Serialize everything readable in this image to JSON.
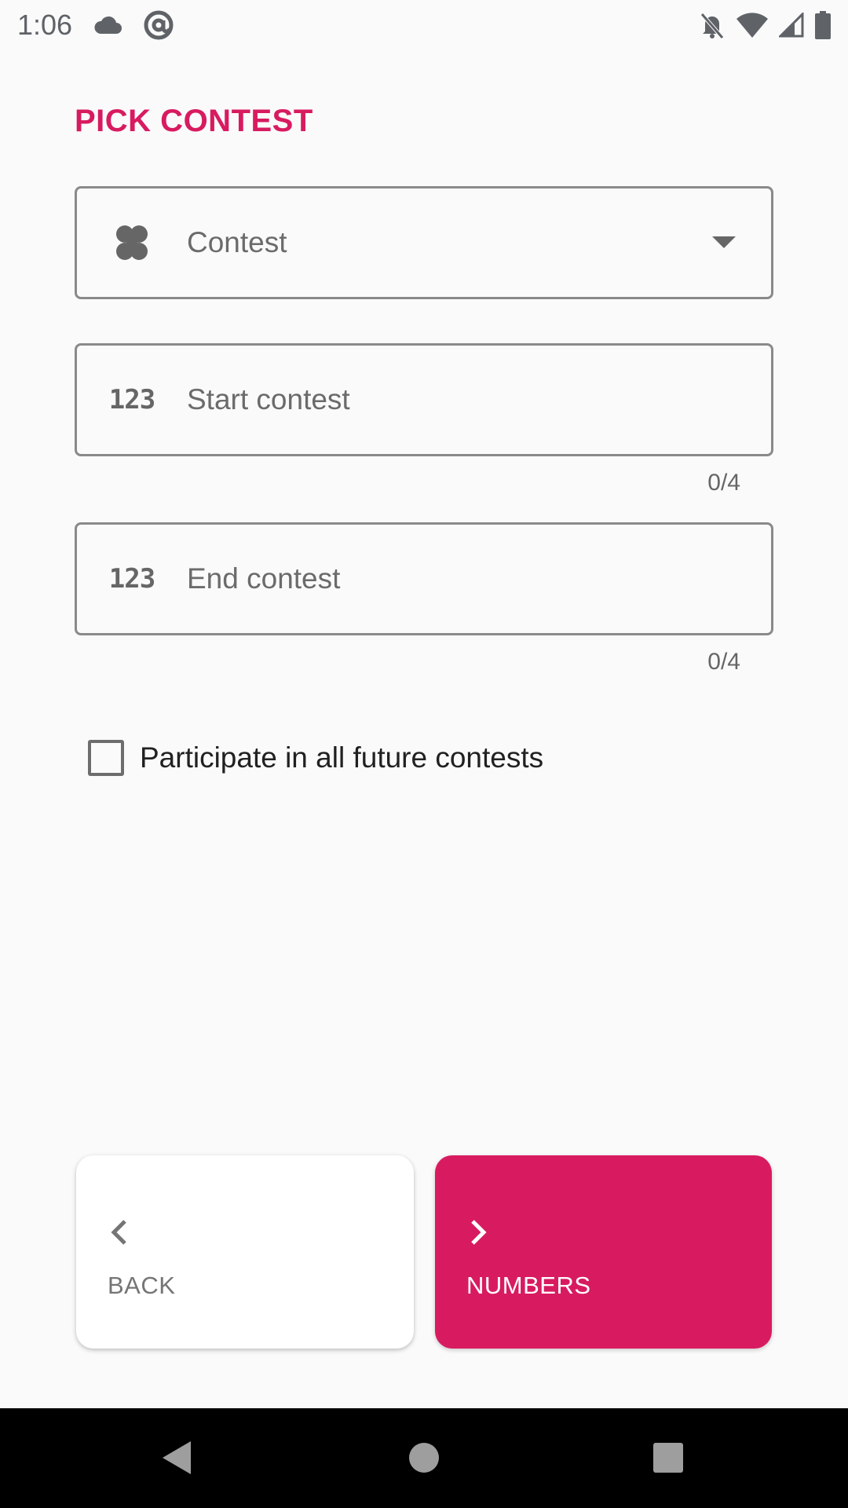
{
  "status_bar": {
    "time": "1:06"
  },
  "page": {
    "title": "PICK CONTEST"
  },
  "fields": {
    "contest": {
      "placeholder": "Contest"
    },
    "start": {
      "placeholder": "Start contest",
      "counter": "0/4",
      "icon_text": "123"
    },
    "end": {
      "placeholder": "End contest",
      "counter": "0/4",
      "icon_text": "123"
    }
  },
  "checkbox": {
    "label": "Participate in all future contests",
    "checked": false
  },
  "buttons": {
    "back": "BACK",
    "next": "NUMBERS"
  },
  "colors": {
    "accent": "#d81b60",
    "background": "#fafafa"
  },
  "icons": {
    "contest": "clover-icon",
    "dropdown": "dropdown-arrow-icon",
    "back": "chevron-left-icon",
    "next": "chevron-right-icon"
  }
}
